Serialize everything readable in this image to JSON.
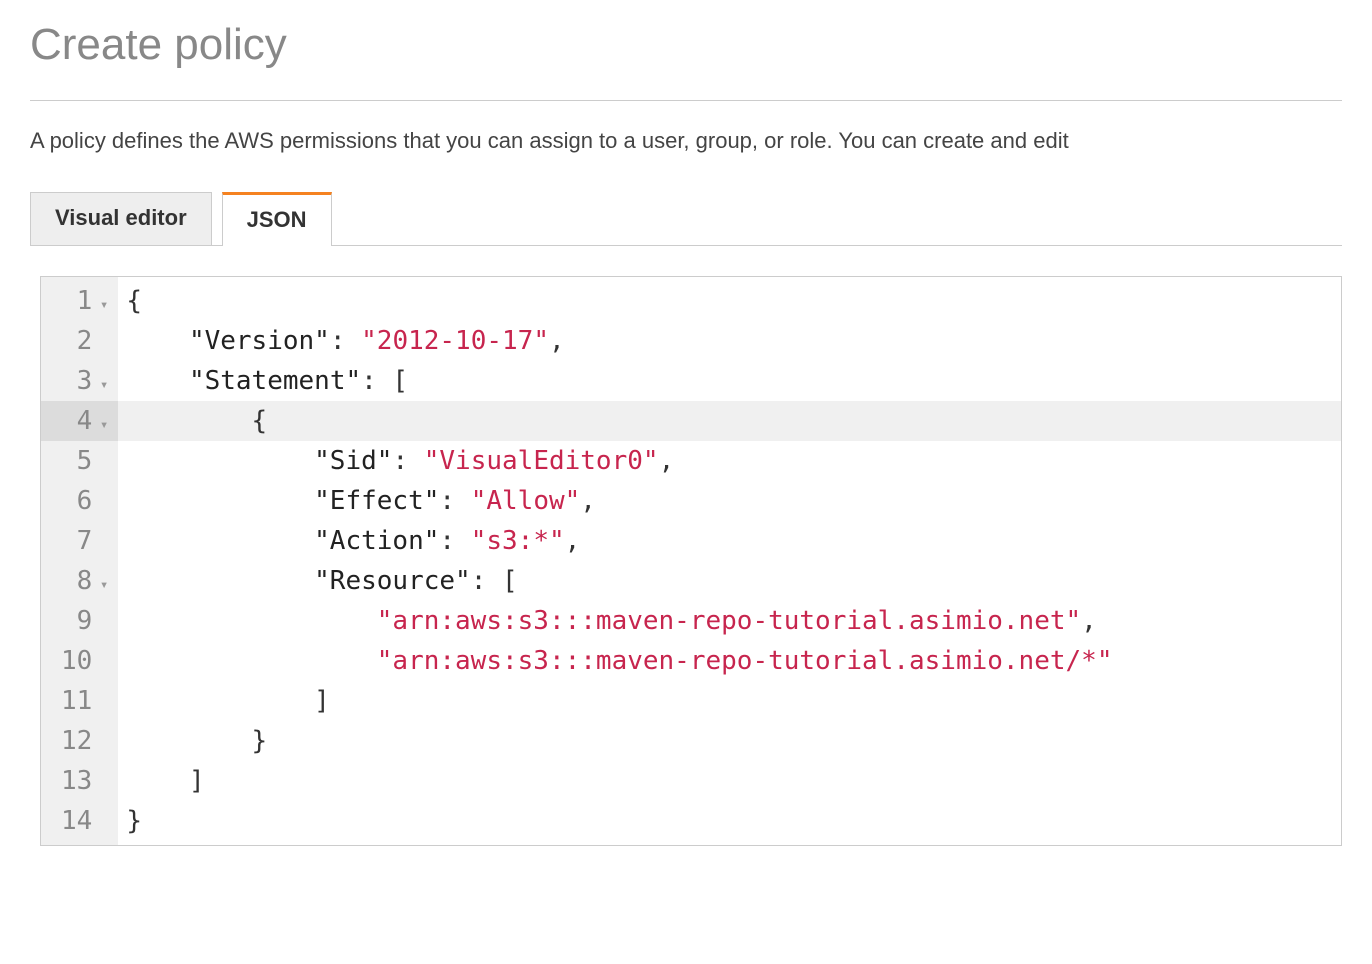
{
  "page": {
    "title": "Create policy",
    "description": "A policy defines the AWS permissions that you can assign to a user, group, or role. You can create and edit "
  },
  "tabs": {
    "visual_editor": "Visual editor",
    "json": "JSON"
  },
  "editor": {
    "line_numbers": [
      "1",
      "2",
      "3",
      "4",
      "5",
      "6",
      "7",
      "8",
      "9",
      "10",
      "11",
      "12",
      "13",
      "14"
    ],
    "foldable_lines": [
      1,
      3,
      4,
      8
    ],
    "active_line": 4,
    "policy": {
      "Version": "2012-10-17",
      "Statement": [
        {
          "Sid": "VisualEditor0",
          "Effect": "Allow",
          "Action": "s3:*",
          "Resource": [
            "arn:aws:s3:::maven-repo-tutorial.asimio.net",
            "arn:aws:s3:::maven-repo-tutorial.asimio.net/*"
          ]
        }
      ]
    },
    "lines": [
      {
        "indent": 0,
        "tokens": [
          {
            "t": "punc",
            "v": "{"
          }
        ]
      },
      {
        "indent": 1,
        "tokens": [
          {
            "t": "key",
            "v": "\"Version\""
          },
          {
            "t": "punc",
            "v": ": "
          },
          {
            "t": "str",
            "v": "\"2012-10-17\""
          },
          {
            "t": "punc",
            "v": ","
          }
        ]
      },
      {
        "indent": 1,
        "tokens": [
          {
            "t": "key",
            "v": "\"Statement\""
          },
          {
            "t": "punc",
            "v": ": ["
          }
        ]
      },
      {
        "indent": 2,
        "tokens": [
          {
            "t": "punc",
            "v": "{"
          }
        ]
      },
      {
        "indent": 3,
        "tokens": [
          {
            "t": "key",
            "v": "\"Sid\""
          },
          {
            "t": "punc",
            "v": ": "
          },
          {
            "t": "str",
            "v": "\"VisualEditor0\""
          },
          {
            "t": "punc",
            "v": ","
          }
        ]
      },
      {
        "indent": 3,
        "tokens": [
          {
            "t": "key",
            "v": "\"Effect\""
          },
          {
            "t": "punc",
            "v": ": "
          },
          {
            "t": "str",
            "v": "\"Allow\""
          },
          {
            "t": "punc",
            "v": ","
          }
        ]
      },
      {
        "indent": 3,
        "tokens": [
          {
            "t": "key",
            "v": "\"Action\""
          },
          {
            "t": "punc",
            "v": ": "
          },
          {
            "t": "str",
            "v": "\"s3:*\""
          },
          {
            "t": "punc",
            "v": ","
          }
        ]
      },
      {
        "indent": 3,
        "tokens": [
          {
            "t": "key",
            "v": "\"Resource\""
          },
          {
            "t": "punc",
            "v": ": ["
          }
        ]
      },
      {
        "indent": 4,
        "tokens": [
          {
            "t": "str",
            "v": "\"arn:aws:s3:::maven-repo-tutorial.asimio.net\""
          },
          {
            "t": "punc",
            "v": ","
          }
        ]
      },
      {
        "indent": 4,
        "tokens": [
          {
            "t": "str",
            "v": "\"arn:aws:s3:::maven-repo-tutorial.asimio.net/*\""
          }
        ]
      },
      {
        "indent": 3,
        "tokens": [
          {
            "t": "punc",
            "v": "]"
          }
        ]
      },
      {
        "indent": 2,
        "tokens": [
          {
            "t": "punc",
            "v": "}"
          }
        ]
      },
      {
        "indent": 1,
        "tokens": [
          {
            "t": "punc",
            "v": "]"
          }
        ]
      },
      {
        "indent": 0,
        "tokens": [
          {
            "t": "punc",
            "v": "}"
          }
        ]
      }
    ]
  }
}
